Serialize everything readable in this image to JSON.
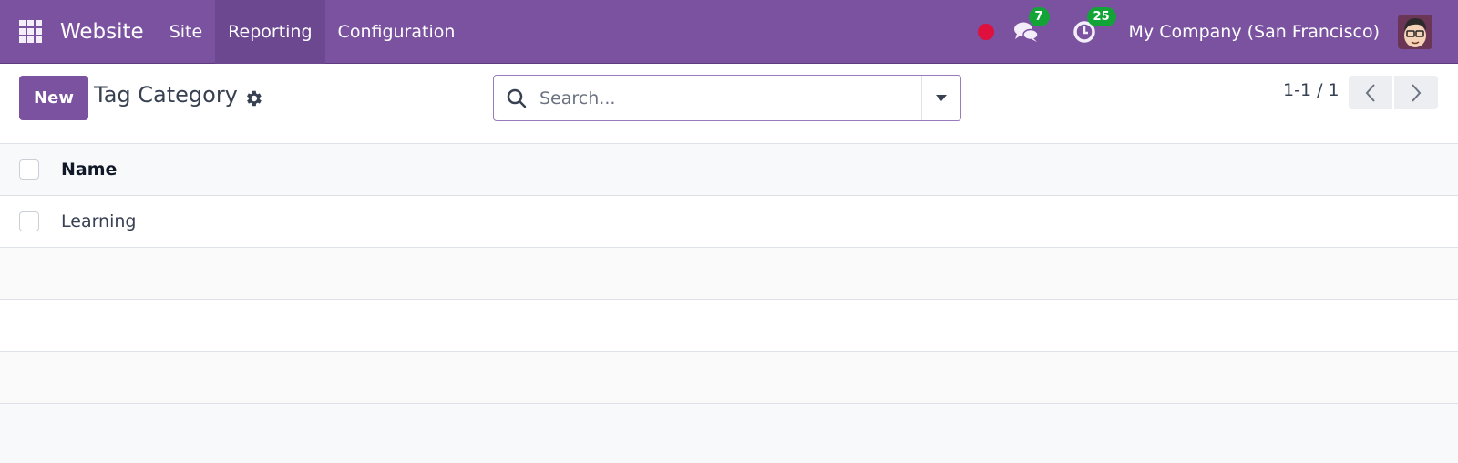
{
  "navbar": {
    "app_name": "Website",
    "menu": [
      {
        "label": "Site",
        "active": false
      },
      {
        "label": "Reporting",
        "active": true
      },
      {
        "label": "Configuration",
        "active": false
      }
    ],
    "messages_count": "7",
    "activities_count": "25",
    "company": "My Company (San Francisco)",
    "colors": {
      "brand": "#7a52a0",
      "badge": "#13a438",
      "record": "#e0103e"
    }
  },
  "control_panel": {
    "new_label": "New",
    "title": "Tag Category",
    "search_placeholder": "Search...",
    "pager": "1-1 / 1"
  },
  "list": {
    "columns": [
      "Name"
    ],
    "rows": [
      {
        "name": "Learning"
      }
    ]
  }
}
